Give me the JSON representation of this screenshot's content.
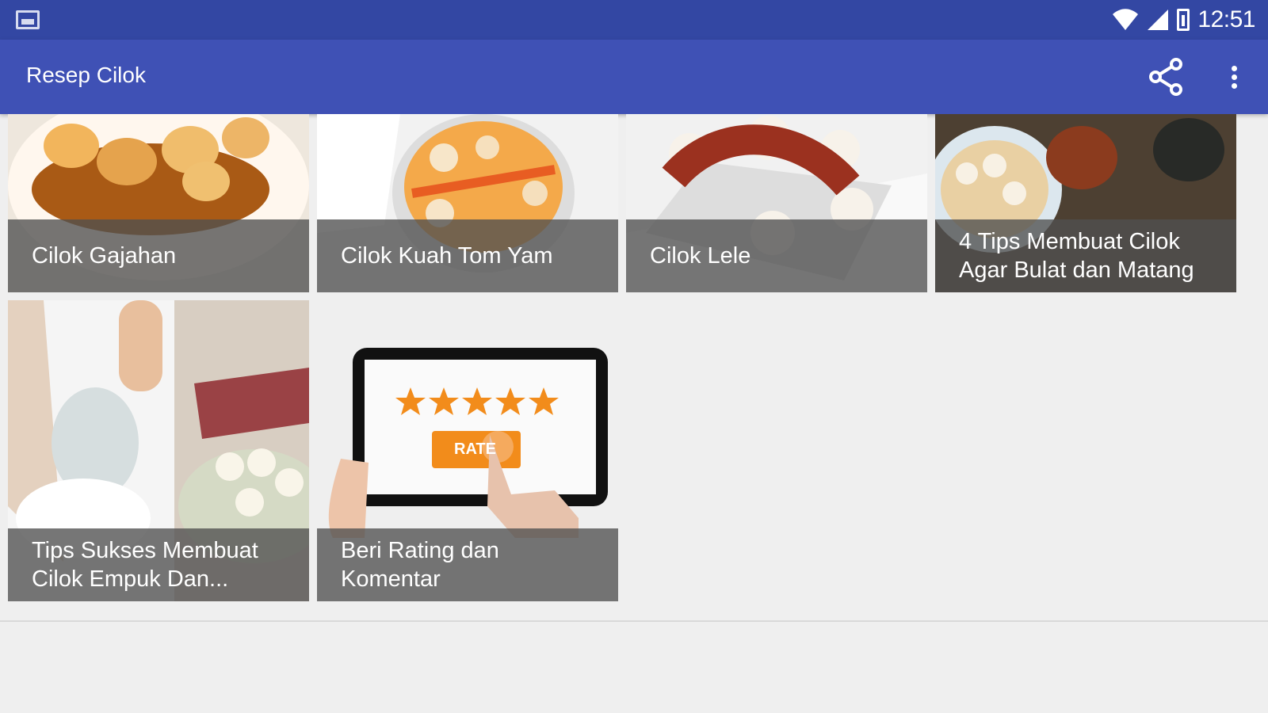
{
  "status": {
    "time": "12:51",
    "icons": [
      "image-icon",
      "wifi-icon",
      "signal-icon",
      "battery-icon"
    ]
  },
  "app": {
    "title": "Resep Cilok",
    "actions": [
      "share-icon",
      "more-vert-icon"
    ],
    "colors": {
      "statusbar": "#3347a3",
      "appbar": "#3f51b5",
      "background": "#efefef"
    }
  },
  "tiles": [
    {
      "title": "Cilok Gajahan"
    },
    {
      "title": "Cilok Kuah Tom Yam"
    },
    {
      "title": "Cilok Lele"
    },
    {
      "title": "4 Tips Membuat Cilok Agar Bulat dan Matang"
    },
    {
      "title": "Tips Sukses Membuat Cilok Empuk Dan..."
    },
    {
      "title": "Beri Rating dan Komentar",
      "button": "RATE"
    }
  ]
}
